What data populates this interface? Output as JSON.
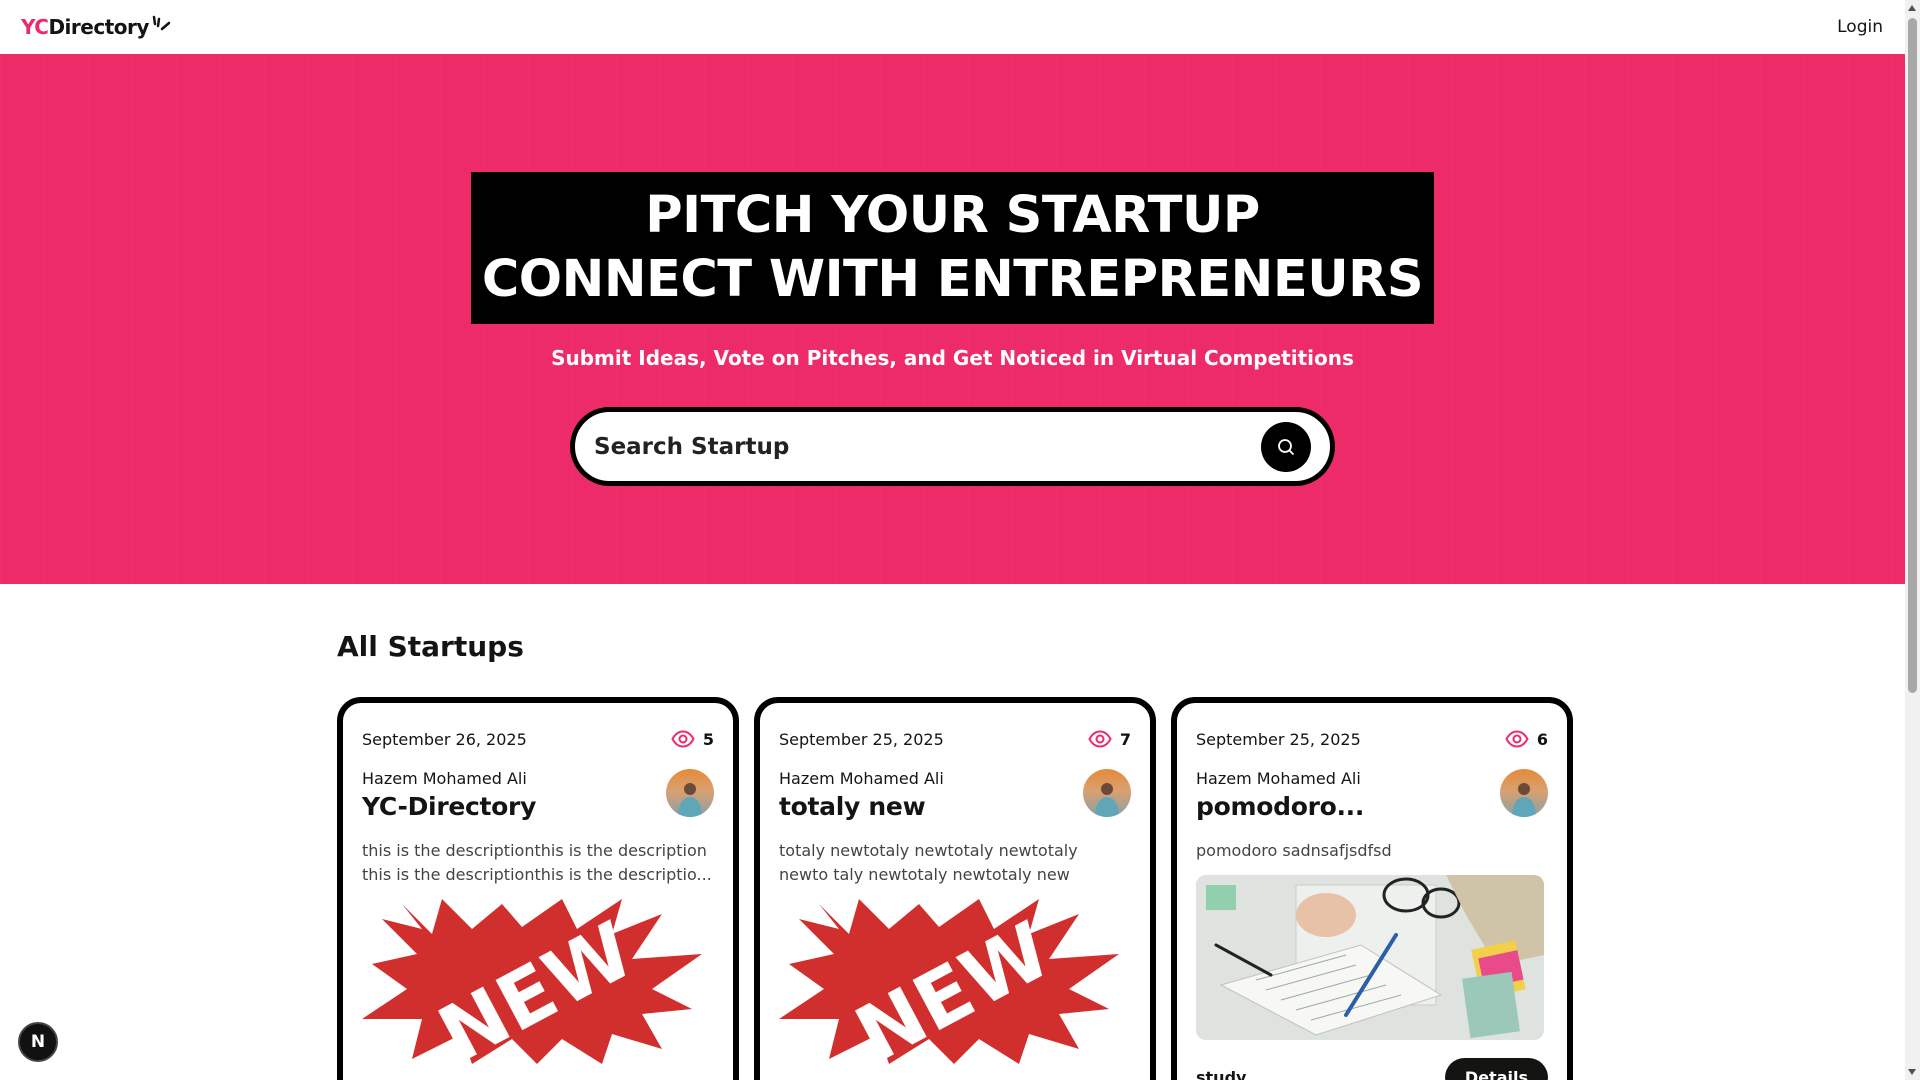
{
  "navbar": {
    "logo_prefix": "YC",
    "logo_rest": "Directory",
    "login": "Login"
  },
  "hero": {
    "line1": "PITCH YOUR STARTUP",
    "line2": "CONNECT WITH ENTREPRENEURS",
    "subtitle": "Submit Ideas, Vote on Pitches, and Get Noticed in Virtual Competitions",
    "search_placeholder": "Search Startup"
  },
  "section": {
    "title": "All Startups"
  },
  "cards": [
    {
      "date": "September 26, 2025",
      "views": "5",
      "author": "Hazem Mohamed Ali",
      "title": "YC-Directory",
      "description": "this is the descriptionthis is the description this is the descriptionthis is the descriptio...",
      "image": "new-burst",
      "image_text": "NEW"
    },
    {
      "date": "September 25, 2025",
      "views": "7",
      "author": "Hazem Mohamed Ali",
      "title": "totaly new",
      "description": "totaly newtotaly newtotaly newtotaly newto taly newtotaly newtotaly new",
      "image": "new-burst",
      "image_text": "NEW"
    },
    {
      "date": "September 25, 2025",
      "views": "6",
      "author": "Hazem Mohamed Ali",
      "title": "pomodoro...",
      "description": "pomodoro sadnsafjsdfsd",
      "image": "study-desk-photo",
      "category": "study",
      "details": "Details"
    }
  ],
  "colors": {
    "primary": "#ee2b69",
    "dark": "#000000",
    "text": "#141413"
  },
  "dev_badge": "N"
}
